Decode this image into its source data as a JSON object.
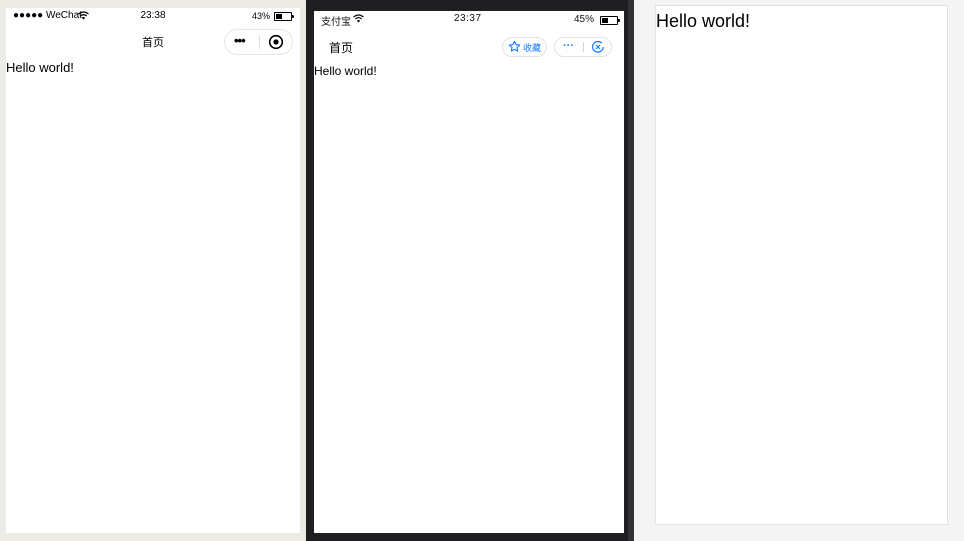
{
  "wechat": {
    "status": {
      "carrier": "●●●●● WeChat",
      "time": "23:38",
      "battery": "43%",
      "battery_level": 0.43
    },
    "nav": {
      "title": "首页",
      "more": "•••"
    },
    "content": "Hello world!"
  },
  "alipay": {
    "status": {
      "carrier": "支付宝",
      "time": "23:37",
      "battery": "45%",
      "battery_level": 0.45
    },
    "nav": {
      "title": "首页",
      "favorite": "收藏",
      "more": "···"
    },
    "content": "Hello world!"
  },
  "web": {
    "content": "Hello world!"
  },
  "colors": {
    "alipay_accent": "#1677ff",
    "device_frame": "#1f1f22",
    "wechat_bg": "#ecebe6"
  },
  "icons": [
    "wifi-icon",
    "battery-icon",
    "target-icon",
    "star-icon",
    "close-circle-icon"
  ]
}
